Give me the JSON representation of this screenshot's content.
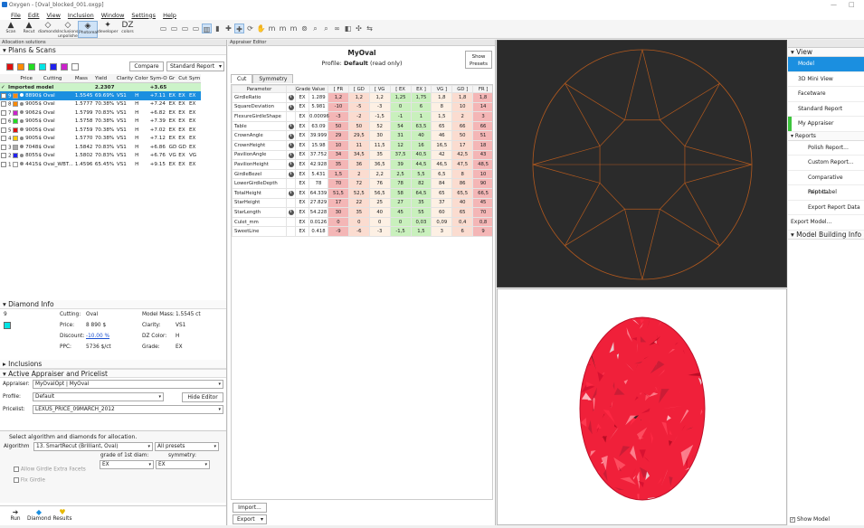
{
  "window": {
    "title": "Oxygen - [Oval_blocked_001.oxgp]",
    "controls": [
      "—",
      "□"
    ]
  },
  "menu": [
    "File",
    "Edit",
    "View",
    "Inclusion",
    "Window",
    "Settings",
    "Help"
  ],
  "toolbar": {
    "big": [
      {
        "label": "Scan",
        "icon": "scan-icon",
        "glyph": "▲"
      },
      {
        "label": "Recut",
        "icon": "recut-icon",
        "glyph": "▲"
      },
      {
        "label": "diamonds",
        "icon": "diamonds-icon",
        "glyph": "◇"
      },
      {
        "label": "Inclusions unpolished",
        "icon": "inclusions-icon",
        "glyph": "◇"
      },
      {
        "label": "Photoreal",
        "icon": "photoreal-icon",
        "glyph": "◈"
      },
      {
        "label": "developer",
        "icon": "developer-icon",
        "glyph": "✦"
      },
      {
        "label": "colors",
        "icon": "colors-icon",
        "glyph": "DZ"
      }
    ],
    "small": [
      "▭",
      "▭",
      "▭",
      "▭",
      "▥",
      "▮",
      "✚",
      "✚",
      "⟳",
      "✋",
      "m",
      "m",
      "m",
      "⊚",
      "⌕",
      "⌕",
      "∞",
      "◧",
      "✣",
      "⇆"
    ]
  },
  "left": {
    "panel_title": "Allocation solutions",
    "plans_title": "Plans & Scans",
    "swatches": [
      "#e01010",
      "#ff8a00",
      "#22dd22",
      "#00e5e5",
      "#2222ee",
      "#cc22cc",
      "#ffffff"
    ],
    "compare_label": "Compare",
    "report_label": "Standard Report",
    "columns": [
      "",
      "",
      "Price",
      "Cutting",
      "Mass",
      "Yield",
      "Clarity",
      "Color",
      "Sym-O",
      "Gr",
      "Cut",
      "Sym"
    ],
    "imported": {
      "label": "Imported model",
      "mass": "2.2307",
      "diff": "+3.65"
    },
    "rows": [
      {
        "num": "9",
        "color": "#ff8a00",
        "price": "8890$",
        "cut": "Oval",
        "mass": "1.5545",
        "yield": "69.69%",
        "cl": "VS1",
        "co": "H",
        "diff": "+7.11",
        "g": "EX",
        "c": "EX",
        "s": "EX",
        "sel": true
      },
      {
        "num": "8",
        "color": "#ff8a00",
        "price": "9005$",
        "cut": "Oval",
        "mass": "1.5777",
        "yield": "70.38%",
        "cl": "VS1",
        "co": "H",
        "diff": "+7.24",
        "g": "EX",
        "c": "EX",
        "s": "EX",
        "sel": false
      },
      {
        "num": "7",
        "color": "#cc22cc",
        "price": "9062$",
        "cut": "Oval",
        "mass": "1.5799",
        "yield": "70.83%",
        "cl": "VS1",
        "co": "H",
        "diff": "+6.82",
        "g": "EX",
        "c": "EX",
        "s": "EX",
        "sel": false
      },
      {
        "num": "6",
        "color": "#22dd22",
        "price": "9005$",
        "cut": "Oval",
        "mass": "1.5758",
        "yield": "70.38%",
        "cl": "VS1",
        "co": "H",
        "diff": "+7.39",
        "g": "EX",
        "c": "EX",
        "s": "EX",
        "sel": false
      },
      {
        "num": "5",
        "color": "#e01010",
        "price": "9005$",
        "cut": "Oval",
        "mass": "1.5759",
        "yield": "70.38%",
        "cl": "VS1",
        "co": "H",
        "diff": "+7.02",
        "g": "EX",
        "c": "EX",
        "s": "EX",
        "sel": false
      },
      {
        "num": "4",
        "color": "#ffcc00",
        "price": "9005$",
        "cut": "Oval",
        "mass": "1.5770",
        "yield": "70.38%",
        "cl": "VS1",
        "co": "H",
        "diff": "+7.12",
        "g": "EX",
        "c": "EX",
        "s": "EX",
        "sel": false
      },
      {
        "num": "3",
        "color": "#aaaaaa",
        "price": "7048$",
        "cut": "Oval",
        "mass": "1.5842",
        "yield": "70.83%",
        "cl": "VS1",
        "co": "H",
        "diff": "+6.86",
        "g": "GD",
        "c": "GD",
        "s": "EX",
        "sel": false
      },
      {
        "num": "2",
        "color": "#2222ee",
        "price": "8055$",
        "cut": "Oval",
        "mass": "1.5802",
        "yield": "70.83%",
        "cl": "VS1",
        "co": "H",
        "diff": "+6.76",
        "g": "VG",
        "c": "EX",
        "s": "VG",
        "sel": false
      },
      {
        "num": "1",
        "color": "",
        "price": "4415$",
        "cut": "Oval_WBT...",
        "mass": "1.4596",
        "yield": "65.45%",
        "cl": "VS1",
        "co": "H",
        "diff": "+9.15",
        "g": "EX",
        "c": "EX",
        "s": "EX",
        "sel": false
      }
    ],
    "diamond_info": {
      "title": "Diamond Info",
      "num": "9",
      "cutting_label": "Cutting:",
      "cutting": "Oval",
      "price_label": "Price:",
      "price": "8 890 $",
      "discount_label": "Discount:",
      "discount": "-10.00 %",
      "ppc_label": "PPC:",
      "ppc": "5736 $/ct",
      "mass_label": "Model Mass:",
      "mass": "1.5545 ct",
      "clarity_label": "Clarity:",
      "clarity": "VS1",
      "color_label": "DZ Color:",
      "color": "H",
      "grade_label": "Grade:",
      "grade": "EX"
    },
    "inclusions_title": "Inclusions",
    "appraiser": {
      "title": "Active Appraiser and Pricelist",
      "appraiser_label": "Appraiser:",
      "appraiser_value": "MyOvalOpt | MyOval",
      "profile_label": "Profile:",
      "profile_value": "Default",
      "hide_editor": "Hide Editor",
      "pricelist_label": "Pricelist:",
      "pricelist_value": "LEXUS_PRICE_09MARCH_2012"
    },
    "algo": {
      "heading": "Select algorithm and diamonds for allocation.",
      "algorithm_label": "Algorithm",
      "algorithm_value": "13. SmartRecut (Brilliant, Oval)",
      "presets_value": "All presets",
      "grade_label": "grade of 1st diam:",
      "grade_value": "EX",
      "sym_label": "symmetry:",
      "sym_value": "EX",
      "extra_facets": "Allow Girdle Extra Facets",
      "fix_girdle": "Fix Girdle"
    },
    "bottom_tabs": [
      {
        "label": "Run",
        "icon": "run-icon",
        "glyph": "➜"
      },
      {
        "label": "Diamond",
        "icon": "diamond-icon",
        "glyph": "◆"
      },
      {
        "label": "Results",
        "icon": "results-icon",
        "glyph": "♥"
      }
    ]
  },
  "editor": {
    "panel_title": "Appraiser Editor",
    "name": "MyOval",
    "profile_prefix": "Profile:",
    "profile": "Default",
    "readonly": "(read only)",
    "show_presets": "Show Presets",
    "tabs": [
      "Cut",
      "Symmetry"
    ],
    "headers": [
      "Parameter",
      "",
      "Grade",
      "Value",
      "[ FR",
      "[ GD",
      "[ VG",
      "[ EX",
      "EX ]",
      "VG ]",
      "GD ]",
      "FR ]"
    ],
    "rows": [
      {
        "name": "GirdleRatio",
        "info": true,
        "grade": "EX",
        "value": "1.289",
        "b": [
          "1,2",
          "1,2",
          "1,2",
          "1,25",
          "1,75",
          "1,8",
          "1,8",
          "1,8"
        ]
      },
      {
        "name": "SquareDeviation",
        "info": true,
        "grade": "EX",
        "value": "5.981",
        "b": [
          "-10",
          "-5",
          "-3",
          "0",
          "6",
          "8",
          "10",
          "14"
        ]
      },
      {
        "name": "FlexureGirdleShape",
        "info": false,
        "grade": "EX",
        "value": "0.00096",
        "b": [
          "-3",
          "-2",
          "-1,5",
          "-1",
          "1",
          "1,5",
          "2",
          "3"
        ]
      },
      {
        "name": "Table",
        "info": true,
        "grade": "EX",
        "value": "63.09",
        "b": [
          "50",
          "50",
          "52",
          "54",
          "63,5",
          "65",
          "66",
          "66"
        ]
      },
      {
        "name": "CrownAngle",
        "info": true,
        "grade": "EX",
        "value": "39.999",
        "b": [
          "29",
          "29,5",
          "30",
          "31",
          "40",
          "46",
          "50",
          "51"
        ]
      },
      {
        "name": "CrownHeight",
        "info": true,
        "grade": "EX",
        "value": "15.98",
        "b": [
          "10",
          "11",
          "11,5",
          "12",
          "16",
          "16,5",
          "17",
          "18"
        ]
      },
      {
        "name": "PavilionAngle",
        "info": true,
        "grade": "EX",
        "value": "37.752",
        "b": [
          "34",
          "34,5",
          "35",
          "37,5",
          "40,5",
          "42",
          "42,5",
          "43"
        ]
      },
      {
        "name": "PavilionHeight",
        "info": true,
        "grade": "EX",
        "value": "42.928",
        "b": [
          "35",
          "36",
          "36,5",
          "39",
          "44,5",
          "46,5",
          "47,5",
          "48,5"
        ]
      },
      {
        "name": "GirdleBezel",
        "info": true,
        "grade": "EX",
        "value": "5.431",
        "b": [
          "1,5",
          "2",
          "2,2",
          "2,5",
          "5,5",
          "6,5",
          "8",
          "10"
        ]
      },
      {
        "name": "LowerGirdleDepth",
        "info": false,
        "grade": "EX",
        "value": "78",
        "b": [
          "70",
          "72",
          "76",
          "78",
          "82",
          "84",
          "86",
          "90"
        ]
      },
      {
        "name": "TotalHeight",
        "info": true,
        "grade": "EX",
        "value": "64.339",
        "b": [
          "51,5",
          "52,5",
          "56,5",
          "58",
          "64,5",
          "65",
          "65,5",
          "66,5"
        ]
      },
      {
        "name": "StarHeight",
        "info": false,
        "grade": "EX",
        "value": "27.829",
        "b": [
          "17",
          "22",
          "25",
          "27",
          "35",
          "37",
          "40",
          "45"
        ]
      },
      {
        "name": "StarLength",
        "info": true,
        "grade": "EX",
        "value": "54.228",
        "b": [
          "30",
          "35",
          "40",
          "45",
          "55",
          "60",
          "65",
          "70"
        ]
      },
      {
        "name": "Culet_mm",
        "info": false,
        "grade": "EX",
        "value": "0.0126",
        "b": [
          "0",
          "0",
          "0",
          "0",
          "0,03",
          "0,09",
          "0,4",
          "0,8"
        ]
      },
      {
        "name": "SweetLine",
        "info": false,
        "grade": "EX",
        "value": "0.418",
        "b": [
          "-9",
          "-6",
          "-3",
          "-1,5",
          "1,5",
          "3",
          "6",
          "9"
        ]
      }
    ],
    "import_label": "Import...",
    "export_label": "Export"
  },
  "colors": {
    "fr": "#f4b6b6",
    "gd": "#fbdcd0",
    "vg": "#fdf0e4",
    "ex": "#c9f0bd",
    "selected": "#1b8fe0",
    "imported": "#ccf3c9",
    "stone": "#f0203a",
    "wire": "#b2591e"
  },
  "right": {
    "view_title": "View",
    "items": [
      {
        "label": "Model",
        "selected": true,
        "icon": ""
      },
      {
        "label": "3D Mini View",
        "selected": false,
        "icon": "3d-icon"
      },
      {
        "label": "Facetware",
        "selected": false,
        "icon": ""
      },
      {
        "label": "Standard Report",
        "selected": false,
        "icon": ""
      },
      {
        "label": "My Appraiser",
        "selected": false,
        "icon": "",
        "mark": true
      }
    ],
    "reports_title": "Reports",
    "reports": [
      "Polish Report...",
      "Custom Report...",
      "Comparative Report...",
      "Print Label",
      "Export Report Data"
    ],
    "export_model": "Export Model...",
    "model_building": "Model Building Info",
    "show_model": "Show Model"
  }
}
